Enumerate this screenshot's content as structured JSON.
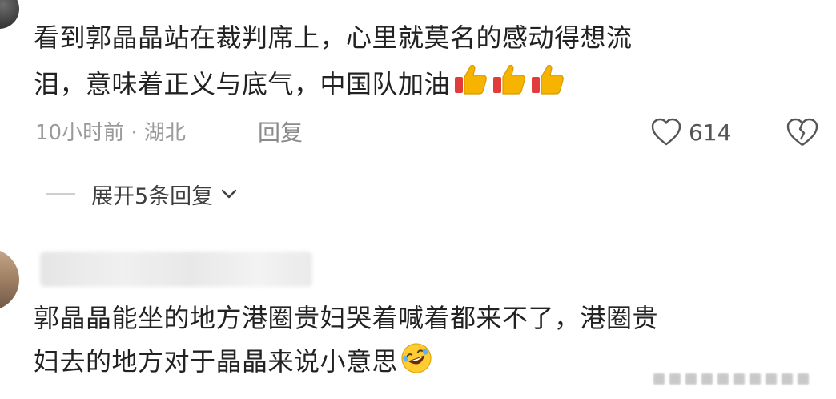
{
  "comment1": {
    "line1": "看到郭晶晶站在裁判席上，心里就莫名的感动得想流",
    "line2": "泪，意味着正义与底气，中国队加油",
    "emoji": [
      "thumbs-up",
      "thumbs-up",
      "thumbs-up"
    ],
    "meta": "10小时前 · 湖北",
    "reply_label": "回复",
    "like_count": "614"
  },
  "expand_replies_label": "展开5条回复",
  "comment2": {
    "line1": "郭晶晶能坐的地方港圈贵妇哭着喊着都来不了，港圈贵",
    "line2": "妇去的地方对于晶晶来说小意思",
    "emoji": "rolling-on-floor-laughing"
  },
  "colors": {
    "text": "#222222",
    "meta": "#9a9a9a",
    "thumb_yellow": "#f6b400",
    "thumb_red": "#e23b3b"
  }
}
